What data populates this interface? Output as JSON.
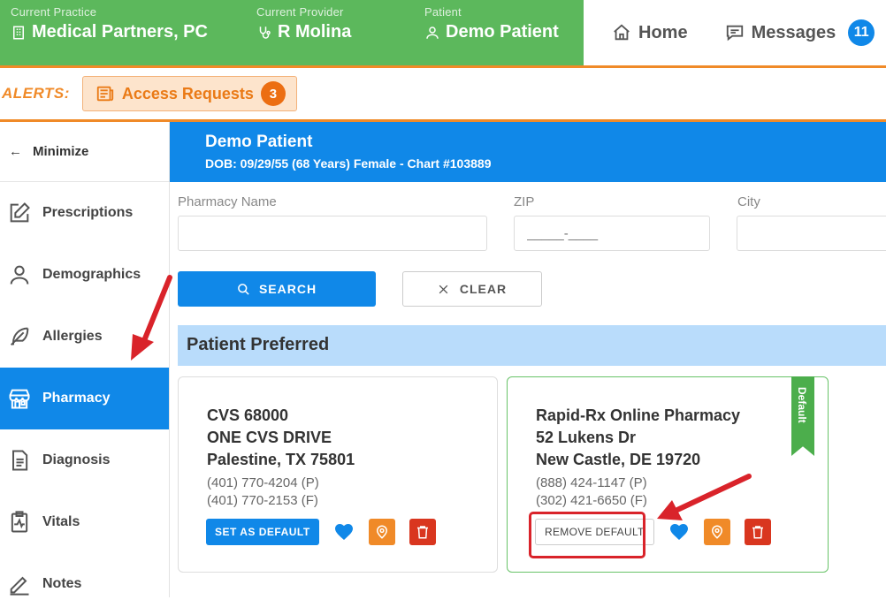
{
  "context": {
    "practice_label": "Current Practice",
    "practice": "Medical Partners, PC",
    "provider_label": "Current Provider",
    "provider": "R Molina",
    "patient_label": "Patient",
    "patient": "Demo Patient"
  },
  "nav": {
    "home": "Home",
    "messages": "Messages",
    "messages_count": "11"
  },
  "alerts": {
    "title": "ALERTS:",
    "access_requests": "Access Requests",
    "access_requests_count": "3"
  },
  "sidebar": {
    "minimize": "Minimize",
    "items": [
      {
        "label": "Prescriptions",
        "icon": "edit-icon"
      },
      {
        "label": "Demographics",
        "icon": "user-icon"
      },
      {
        "label": "Allergies",
        "icon": "feather-icon"
      },
      {
        "label": "Pharmacy",
        "icon": "store-icon",
        "active": true
      },
      {
        "label": "Diagnosis",
        "icon": "document-icon"
      },
      {
        "label": "Vitals",
        "icon": "heart-monitor-icon"
      },
      {
        "label": "Notes",
        "icon": "pen-icon"
      }
    ]
  },
  "patient_header": {
    "name": "Demo Patient",
    "details": "DOB: 09/29/55 (68 Years) Female - Chart #103889"
  },
  "search": {
    "pharmacy_name_label": "Pharmacy Name",
    "pharmacy_name_value": "",
    "zip_label": "ZIP",
    "zip_placeholder": "_____-____",
    "city_label": "City",
    "city_value": "",
    "search_button": "SEARCH",
    "clear_button": "CLEAR"
  },
  "section_title": "Patient Preferred",
  "pharmacies": [
    {
      "name": "CVS 68000",
      "address1": "ONE CVS DRIVE",
      "address2": "Palestine, TX 75801",
      "phone": "(401) 770-4204 (P)",
      "fax": "(401) 770-2153 (F)",
      "action": "SET AS DEFAULT"
    },
    {
      "name": "Rapid-Rx Online Pharmacy",
      "address1": "52 Lukens Dr",
      "address2": "New Castle, DE 19720",
      "phone": "(888) 424-1147 (P)",
      "fax": "(302) 421-6650 (F)",
      "action": "REMOVE DEFAULT",
      "ribbon": "Default"
    }
  ],
  "colors": {
    "brand_green": "#5cb85c",
    "primary_blue": "#1088e8",
    "alert_orange": "#f08a28",
    "danger_red": "#d9361f",
    "annotation_red": "#d9232a"
  }
}
